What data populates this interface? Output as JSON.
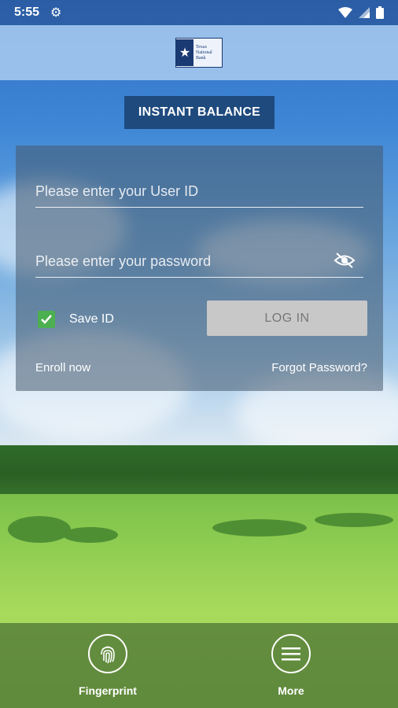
{
  "status_bar": {
    "time": "5:55",
    "icons": [
      "gear-icon",
      "wifi-icon",
      "signal-icon",
      "battery-icon"
    ]
  },
  "header": {
    "logo_icon": "star-icon",
    "logo_lines": [
      "Texas",
      "National",
      "Bank"
    ]
  },
  "instant_balance": {
    "label": "INSTANT BALANCE"
  },
  "login": {
    "user_id_placeholder": "Please enter your User ID",
    "password_placeholder": "Please enter your password",
    "password_toggle_icon": "eye-off-icon",
    "save_id": {
      "label": "Save ID",
      "checked": true
    },
    "login_button": "LOG IN",
    "enroll_link": "Enroll now",
    "forgot_link": "Forgot Password?"
  },
  "bottom_nav": {
    "fingerprint": {
      "label": "Fingerprint",
      "icon": "fingerprint-icon"
    },
    "more": {
      "label": "More",
      "icon": "menu-icon"
    }
  },
  "colors": {
    "header_bg": "#aacdf0",
    "button_blue": "#1f4a7e",
    "checkbox_green": "#4caf50",
    "login_button_bg": "#c8c8c8"
  }
}
